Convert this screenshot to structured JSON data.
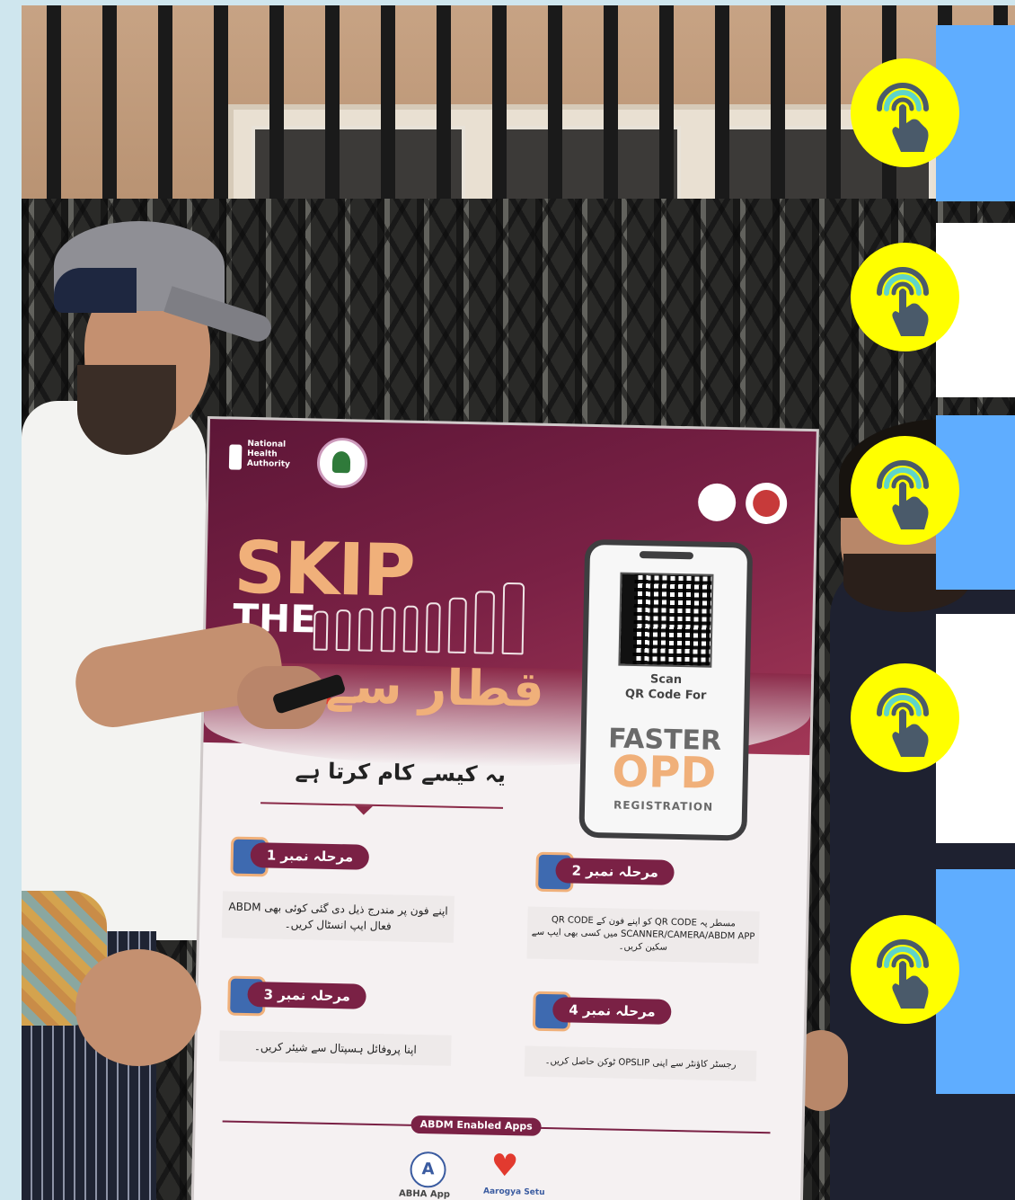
{
  "poster": {
    "org_name": "National Health Authority",
    "headline_skip": "SKIP",
    "headline_the": "THE",
    "headline_urdu": "قطار سے",
    "scan_line1": "Scan",
    "scan_line2": "QR Code For",
    "faster": "FASTER",
    "opd": "OPD",
    "registration": "REGISTRATION",
    "how_it_works": "یہ کیسے کام کرتا ہے",
    "steps": [
      {
        "badge": "مرحلہ نمبر 1",
        "text": "اپنے فون پر مندرج ذیل دی گئی کوئی بھی ABDM فعال ایپ انسٹال کریں۔"
      },
      {
        "badge": "مرحلہ نمبر 2",
        "text": "مسطر پہ QR CODE کو اپنے فون کے QR CODE SCANNER/CAMERA/ABDM APP میں کسی بھی ایپ سے سکین کریں۔"
      },
      {
        "badge": "مرحلہ نمبر 3",
        "text": "اپنا پروفائل ہسپتال سے شیئر کریں۔"
      },
      {
        "badge": "مرحلہ نمبر 4",
        "text": "رجسٹر کاؤنٹر سے اپنی OPSLIP ٹوکن حاصل کریں۔"
      }
    ],
    "abdm_enabled_apps": "ABDM Enabled Apps",
    "app1_label": "ABHA App",
    "app2_label": "Aarogya Setu"
  },
  "overlay": {
    "buttons": [
      {
        "icon": "tap-finger-icon",
        "strip_color": "#5fadff"
      },
      {
        "icon": "tap-finger-icon",
        "strip_color": "#ffffff"
      },
      {
        "icon": "tap-finger-icon",
        "strip_color": "#5fadff"
      },
      {
        "icon": "tap-finger-icon",
        "strip_color": "#ffffff"
      },
      {
        "icon": "tap-finger-icon",
        "strip_color": "#5fadff"
      }
    ],
    "button_color": "#ffff00",
    "icon_color": "#4a5a6a",
    "ring_color": "#5fd4c8"
  }
}
